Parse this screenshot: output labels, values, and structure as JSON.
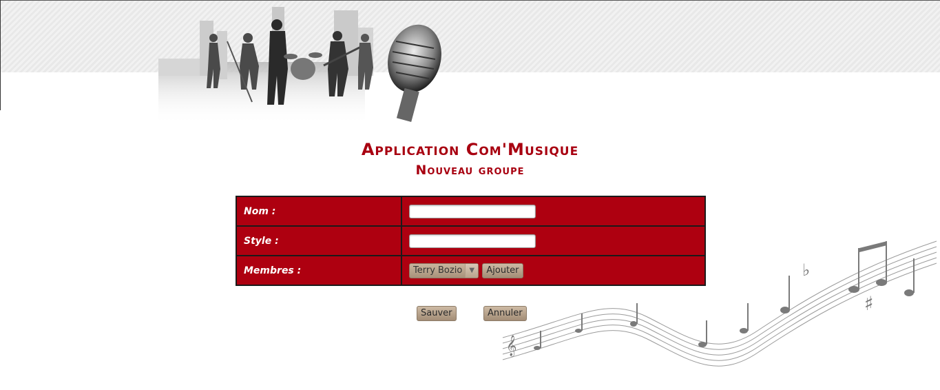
{
  "header": {
    "app_title": "Application Com'Musique",
    "page_title": "Nouveau groupe"
  },
  "form": {
    "rows": [
      {
        "label": "Nom :",
        "value": ""
      },
      {
        "label": "Style :",
        "value": ""
      },
      {
        "label": "Membres :",
        "selected_member": "Terry Bozio",
        "add_label": "Ajouter"
      }
    ]
  },
  "actions": {
    "save_label": "Sauver",
    "cancel_label": "Annuler"
  },
  "colors": {
    "accent": "#ae0010",
    "title": "#a80010",
    "button": "#b8a38c"
  },
  "icons": {
    "banner": "band-silhouette-microphone-image",
    "decor": "music-notes-decoration",
    "select_arrow": "chevron-down-icon"
  }
}
